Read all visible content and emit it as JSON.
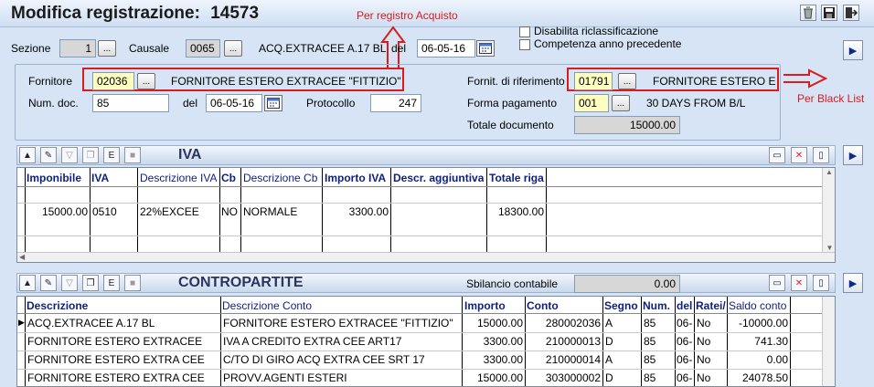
{
  "window": {
    "title": "Modifica registrazione:",
    "record_number": "14573"
  },
  "header": {
    "sezione_label": "Sezione",
    "sezione_value": "1",
    "causale_label": "Causale",
    "causale_value": "0065",
    "causale_desc": "ACQ.EXTRACEE A.17 BL",
    "del_label": "del",
    "date_value": "06-05-16",
    "disabilita_label": "Disabilita riclassificazione",
    "competenza_label": "Competenza anno precedente"
  },
  "supplier": {
    "fornitore_label": "Fornitore",
    "fornitore_code": "02036",
    "fornitore_name": "FORNITORE ESTERO EXTRACEE \"FITTIZIO\"",
    "numdoc_label": "Num. doc.",
    "numdoc_value": "85",
    "del_label": "del",
    "doc_date": "06-05-16",
    "protocollo_label": "Protocollo",
    "protocollo_value": "247",
    "fornit_rif_label": "Fornit. di riferimento",
    "fornit_rif_code": "01791",
    "fornit_rif_name": "FORNITORE ESTERO EX",
    "forma_pag_label": "Forma pagamento",
    "forma_pag_code": "001",
    "forma_pag_desc": "30 DAYS FROM B/L",
    "totale_label": "Totale documento",
    "totale_value": "15000.00"
  },
  "annotations": {
    "registro": "Per registro Acquisto",
    "blacklist": "Per Black List"
  },
  "iva": {
    "title": "IVA",
    "columns": [
      "Imponibile",
      "IVA",
      "Descrizione IVA",
      "Cb",
      "Descrizione Cb",
      "Importo IVA",
      "Descr. aggiuntiva",
      "Totale riga"
    ],
    "rows": [
      {
        "imponibile": "15000.00",
        "iva": "0510",
        "descr_iva": "22%EXCEE",
        "cb": "NO",
        "descr_cb": "NORMALE",
        "importo_iva": "3300.00",
        "descr_agg": "",
        "totale": "18300.00"
      }
    ]
  },
  "contropartite": {
    "title": "CONTROPARTITE",
    "sbilancio_label": "Sbilancio contabile",
    "sbilancio_value": "0.00",
    "columns": [
      "Descrizione",
      "Descrizione Conto",
      "Importo",
      "Conto",
      "Segno",
      "Num.",
      "del",
      "Ratei/",
      "Saldo conto"
    ],
    "rows": [
      {
        "descrizione": "ACQ.EXTRACEE A.17 BL",
        "descr_conto": "FORNITORE ESTERO EXTRACEE \"FITTIZIO\"",
        "importo": "15000.00",
        "conto": "280002036",
        "segno": "A",
        "num": "85",
        "del": "06-",
        "ratei": "No",
        "saldo": "-10000.00"
      },
      {
        "descrizione": "FORNITORE ESTERO EXTRACEE",
        "descr_conto": "IVA A CREDITO EXTRA CEE ART17",
        "importo": "3300.00",
        "conto": "210000013",
        "segno": "D",
        "num": "85",
        "del": "06-",
        "ratei": "No",
        "saldo": "741.30"
      },
      {
        "descrizione": "FORNITORE ESTERO EXTRA CEE",
        "descr_conto": "C/TO DI GIRO ACQ EXTRA CEE SRT 17",
        "importo": "3300.00",
        "conto": "210000014",
        "segno": "A",
        "num": "85",
        "del": "06-",
        "ratei": "No",
        "saldo": "0.00"
      },
      {
        "descrizione": "FORNITORE ESTERO EXTRA CEE",
        "descr_conto": "PROVV.AGENTI ESTERI",
        "importo": "15000.00",
        "conto": "303000002",
        "segno": "D",
        "num": "85",
        "del": "06-",
        "ratei": "No",
        "saldo": "24078.50"
      }
    ]
  },
  "icons": {
    "header": [
      "recycle-icon",
      "save-icon",
      "exit-icon"
    ],
    "toolbar": [
      "move-up-icon",
      "edit-icon",
      "filter-icon",
      "copy-icon",
      "export-icon",
      "lock-icon"
    ],
    "grid_actions": [
      "window-icon",
      "delete-icon",
      "new-document-icon"
    ]
  }
}
